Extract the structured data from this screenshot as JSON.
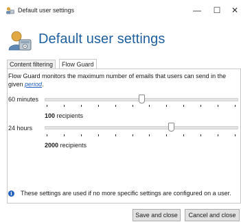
{
  "window": {
    "title": "Default user settings",
    "minimize_glyph": "—",
    "maximize_glyph": "☐",
    "close_glyph": "✕"
  },
  "header": {
    "title": "Default user settings",
    "icon": "user-settings-icon"
  },
  "tabs": [
    {
      "label": "Content filtering",
      "active": false
    },
    {
      "label": "Flow Guard",
      "active": true
    }
  ],
  "flow_guard": {
    "description_prefix": "Flow Guard monitors the maximum number of emails that users can send in the given ",
    "description_link": "period",
    "description_suffix": ".",
    "sliders": [
      {
        "period": "60 minutes",
        "value": "100",
        "unit": " recipients",
        "level": 0.5
      },
      {
        "period": "24 hours",
        "value": "2000",
        "unit": " recipients",
        "level": 0.66
      }
    ]
  },
  "info": {
    "icon": "info-icon",
    "text": "These settings are used if no more specific settings are configured on a user."
  },
  "buttons": {
    "save": "Save and close",
    "cancel": "Cancel and close"
  },
  "colors": {
    "accent": "#1f5f9f",
    "link": "#1f5fbf"
  }
}
